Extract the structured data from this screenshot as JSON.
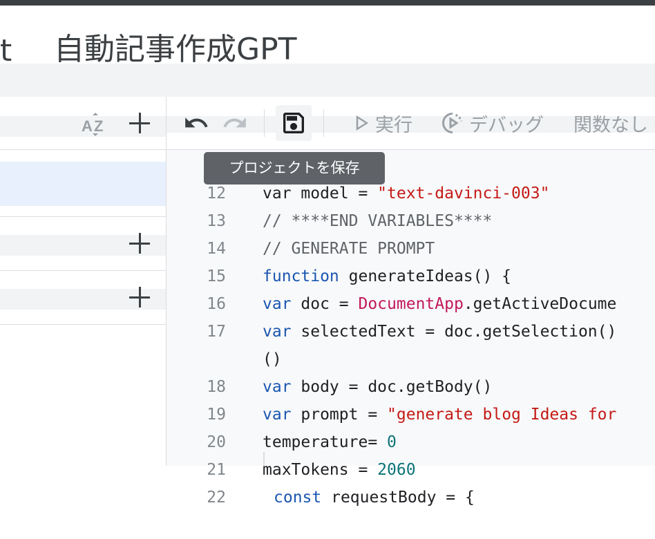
{
  "window": {
    "title_cut": "t",
    "title": "自動記事作成GPT"
  },
  "left_panel": {
    "sort_icon": "sort-az-icon",
    "add_icon": "plus-icon"
  },
  "toolbar": {
    "undo_icon": "undo-icon",
    "redo_icon": "redo-icon",
    "save_icon": "save-icon",
    "run_label": "実行",
    "debug_label": "デバッグ",
    "function_label": "関数なし"
  },
  "tooltip": {
    "text": "プロジェクトを保存"
  },
  "code": {
    "line12": {
      "num": "12",
      "head": "var model = ",
      "str": "\"text-davinci-003\""
    },
    "line13": {
      "num": "13",
      "text": "// ****END VARIABLES****"
    },
    "line14": {
      "num": "14",
      "text": "// GENERATE PROMPT"
    },
    "line15": {
      "num": "15",
      "kw": "function",
      "rest": " generateIdeas() {"
    },
    "line16": {
      "num": "16",
      "kw": "var",
      "mid": " doc = ",
      "cls": "DocumentApp",
      "rest": ".getActiveDocume"
    },
    "line17": {
      "num": "17",
      "kw": "var",
      "rest": " selectedText = doc.getSelection()"
    },
    "line17b": {
      "text": "()"
    },
    "line18": {
      "num": "18",
      "kw": "var",
      "rest": " body = doc.getBody()"
    },
    "line19": {
      "num": "19",
      "kw": "var",
      "mid": " prompt = ",
      "str": "\"generate blog Ideas for"
    },
    "line20": {
      "num": "20",
      "text": "temperature= ",
      "numval": "0"
    },
    "line21": {
      "num": "21",
      "text": "maxTokens = ",
      "numval": "2060"
    },
    "line22": {
      "num": "22",
      "kw": "const",
      "rest": " requestBody = {"
    }
  },
  "colors": {
    "keyword": "#1a56b0",
    "string": "#c41a16",
    "class": "#c2185b",
    "number": "#0d7377",
    "selection": "#e8f0fe"
  }
}
